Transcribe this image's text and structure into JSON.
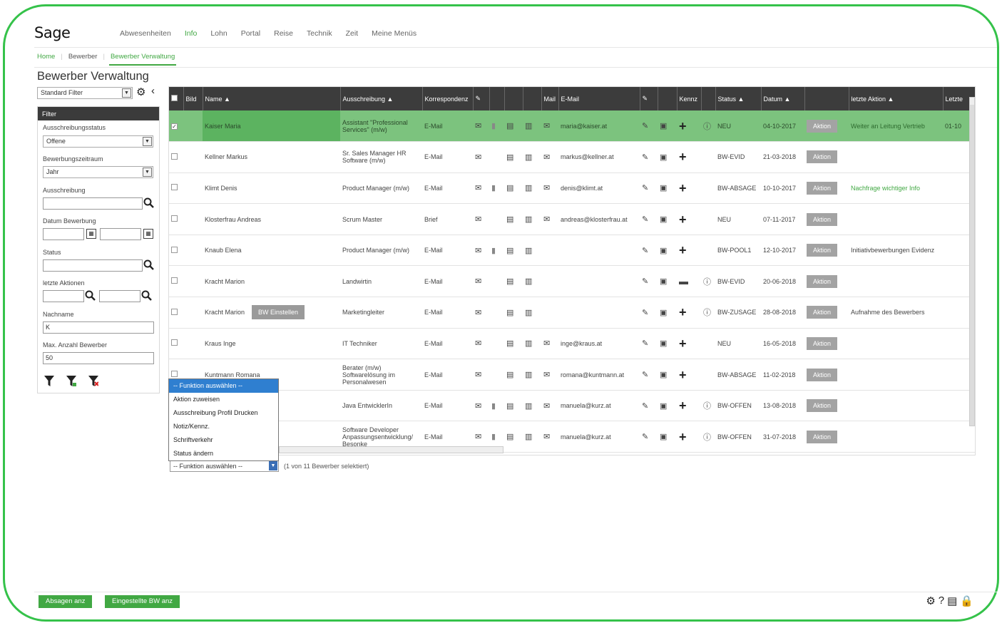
{
  "app": {
    "logo": "Sage",
    "menu": [
      "Abwesenheiten",
      "Info",
      "Lohn",
      "Portal",
      "Reise",
      "Technik",
      "Zeit",
      "Meine Menüs"
    ],
    "active_menu": "Info"
  },
  "breadcrumb": [
    "Home",
    "Bewerber",
    "Bewerber Verwaltung"
  ],
  "page_title": "Bewerber Verwaltung",
  "filter": {
    "preset": "Standard Filter",
    "header": "Filter",
    "ausschreibungsstatus_label": "Ausschreibungsstatus",
    "ausschreibungsstatus_value": "Offene",
    "zeitraum_label": "Bewerbungszeitraum",
    "zeitraum_value": "Jahr",
    "ausschreibung_label": "Ausschreibung",
    "datum_label": "Datum Bewerbung",
    "status_label": "Status",
    "aktionen_label": "letzte Aktionen",
    "nachname_label": "Nachname",
    "nachname_value": "K",
    "max_label": "Max. Anzahl Bewerber",
    "max_value": "50"
  },
  "table": {
    "headers": {
      "bild": "Bild",
      "name": "Name ▲",
      "ausschreibung": "Ausschreibung ▲",
      "korrespondenz": "Korrespondenz",
      "mail": "Mail",
      "email": "E-Mail",
      "kennz": "Kennz",
      "status": "Status ▲",
      "datum": "Datum ▲",
      "letzte_aktion": "letzte Aktion ▲",
      "letzte_extra": "Letzte"
    },
    "aktion_label": "Aktion",
    "bw_button": "BW Einstellen",
    "rows": [
      {
        "name": "Kaiser Maria",
        "ausschreibung": "Assistant \"Professional Services\" (m/w)",
        "korr": "E-Mail",
        "clip": true,
        "doc": true,
        "mail": true,
        "email": "maria@kaiser.at",
        "kennz": "plus",
        "info": true,
        "status": "NEU",
        "datum": "04-10-2017",
        "letzte": "Weiter an Leitung Vertrieb",
        "extra": "01-10"
      },
      {
        "name": "Kellner Markus",
        "ausschreibung": "Sr. Sales Manager HR Software (m/w)",
        "korr": "E-Mail",
        "clip": false,
        "doc": true,
        "mail": true,
        "email": "markus@kellner.at",
        "kennz": "plus",
        "info": false,
        "status": "BW-EVID",
        "datum": "21-03-2018",
        "letzte": "",
        "extra": ""
      },
      {
        "name": "Klimt Denis",
        "ausschreibung": "Product Manager (m/w)",
        "korr": "E-Mail",
        "clip": true,
        "doc": true,
        "mail": true,
        "email": "denis@klimt.at",
        "kennz": "plus",
        "info": false,
        "status": "BW-ABSAGE",
        "datum": "10-10-2017",
        "letzte": "Nachfrage wichtiger Info",
        "extra": ""
      },
      {
        "name": "Klosterfrau Andreas",
        "ausschreibung": "Scrum Master",
        "korr": "Brief",
        "clip": false,
        "doc": true,
        "mail": true,
        "email": "andreas@klosterfrau.at",
        "kennz": "plus",
        "info": false,
        "status": "NEU",
        "datum": "07-11-2017",
        "letzte": "",
        "extra": ""
      },
      {
        "name": "Knaub Elena",
        "ausschreibung": "Product Manager (m/w)",
        "korr": "E-Mail",
        "clip": true,
        "doc": true,
        "mail": false,
        "email": "",
        "kennz": "plus",
        "info": false,
        "status": "BW-POOL1",
        "datum": "12-10-2017",
        "letzte": "Initiativbewerbungen Evidenz",
        "extra": ""
      },
      {
        "name": "Kracht Marion",
        "ausschreibung": "Landwirtin",
        "korr": "E-Mail",
        "clip": false,
        "doc": true,
        "mail": false,
        "email": "",
        "kennz": "comment",
        "info": true,
        "status": "BW-EVID",
        "datum": "20-06-2018",
        "letzte": "",
        "extra": ""
      },
      {
        "name": "Kracht Marion",
        "ausschreibung": "Marketingleiter",
        "korr": "E-Mail",
        "clip": false,
        "doc": true,
        "mail": false,
        "email": "",
        "kennz": "plus",
        "info": true,
        "status": "BW-ZUSAGE",
        "datum": "28-08-2018",
        "letzte": "Aufnahme des Bewerbers",
        "extra": "",
        "bw": true
      },
      {
        "name": "Kraus Inge",
        "ausschreibung": "IT Techniker",
        "korr": "E-Mail",
        "clip": false,
        "doc": true,
        "mail": true,
        "email": "inge@kraus.at",
        "kennz": "plus",
        "info": false,
        "status": "NEU",
        "datum": "16-05-2018",
        "letzte": "",
        "extra": ""
      },
      {
        "name": "Kuntmann Romana",
        "ausschreibung": "Berater (m/w) Softwarelösung im Personalwesen",
        "korr": "E-Mail",
        "clip": false,
        "doc": true,
        "mail": true,
        "email": "romana@kuntmann.at",
        "kennz": "plus",
        "info": false,
        "status": "BW-ABSAGE",
        "datum": "11-02-2018",
        "letzte": "",
        "extra": ""
      },
      {
        "name": "",
        "ausschreibung": "Java EntwicklerIn",
        "korr": "E-Mail",
        "clip": true,
        "doc": true,
        "mail": true,
        "email": "manuela@kurz.at",
        "kennz": "plus",
        "info": true,
        "status": "BW-OFFEN",
        "datum": "13-08-2018",
        "letzte": "",
        "extra": ""
      },
      {
        "name": "",
        "ausschreibung": "Software Developer Anpassungsentwicklung/ Besonke",
        "korr": "E-Mail",
        "clip": true,
        "doc": true,
        "mail": true,
        "email": "manuela@kurz.at",
        "kennz": "plus",
        "info": true,
        "status": "BW-OFFEN",
        "datum": "31-07-2018",
        "letzte": "",
        "extra": ""
      }
    ]
  },
  "function_dropdown": {
    "options": [
      "-- Funktion auswählen --",
      "Aktion zuweisen",
      "Ausschreibung Profil Drucken",
      "Notiz/Kennz.",
      "Schriftverkehr",
      "Status ändern"
    ],
    "selected": "-- Funktion auswählen --",
    "selection_info": "(1 von 11 Bewerber selektiert)"
  },
  "footer": {
    "btn_absagen": "Absagen anz",
    "btn_eingestellte": "Eingestellte BW anz"
  },
  "colors": {
    "accent": "#41a843",
    "highlight_row": "#7cc37e",
    "header_bg": "#3c3c3c",
    "frame": "#35c24a"
  }
}
